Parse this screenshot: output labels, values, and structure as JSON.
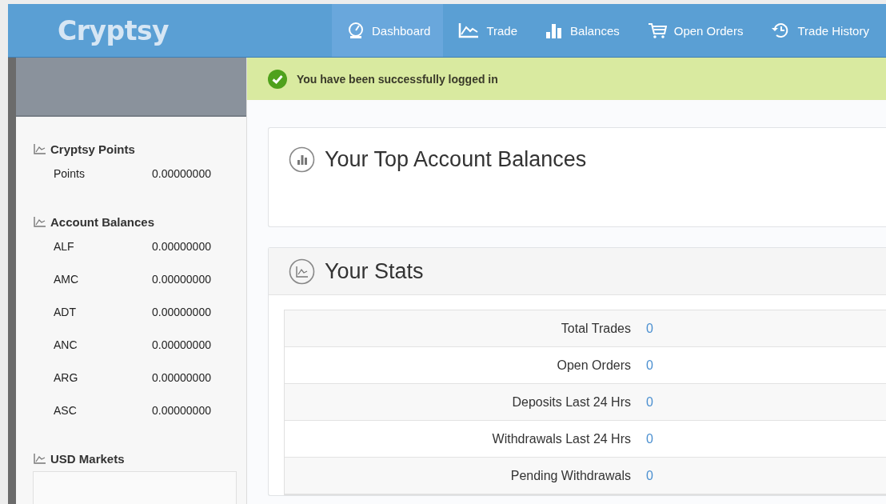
{
  "header": {
    "logo": "Cryptsy",
    "nav": [
      {
        "label": "Dashboard",
        "kind": "dashboard",
        "selected": true
      },
      {
        "label": "Trade",
        "kind": "trade",
        "selected": false
      },
      {
        "label": "Balances",
        "kind": "balances",
        "selected": false
      },
      {
        "label": "Open Orders",
        "kind": "orders",
        "selected": false
      },
      {
        "label": "Trade History",
        "kind": "history",
        "selected": false
      }
    ]
  },
  "sidebar": {
    "sections": [
      {
        "title": "Cryptsy Points",
        "rows": [
          {
            "name": "Points",
            "value": "0.00000000"
          }
        ]
      },
      {
        "title": "Account Balances",
        "rows": [
          {
            "name": "ALF",
            "value": "0.00000000"
          },
          {
            "name": "AMC",
            "value": "0.00000000"
          },
          {
            "name": "ADT",
            "value": "0.00000000"
          },
          {
            "name": "ANC",
            "value": "0.00000000"
          },
          {
            "name": "ARG",
            "value": "0.00000000"
          },
          {
            "name": "ASC",
            "value": "0.00000000"
          }
        ]
      },
      {
        "title": "USD Markets"
      }
    ]
  },
  "alert": {
    "message": "You have been successfully logged in"
  },
  "panels": [
    {
      "title": "Your Top Account Balances",
      "kind": "bars"
    },
    {
      "title": "Your Stats",
      "kind": "chart"
    }
  ],
  "stats": [
    {
      "label": "Total Trades",
      "value": "0"
    },
    {
      "label": "Open Orders",
      "value": "0"
    },
    {
      "label": "Deposits Last 24 Hrs",
      "value": "0"
    },
    {
      "label": "Withdrawals Last 24 Hrs",
      "value": "0"
    },
    {
      "label": "Pending Withdrawals",
      "value": "0"
    }
  ]
}
